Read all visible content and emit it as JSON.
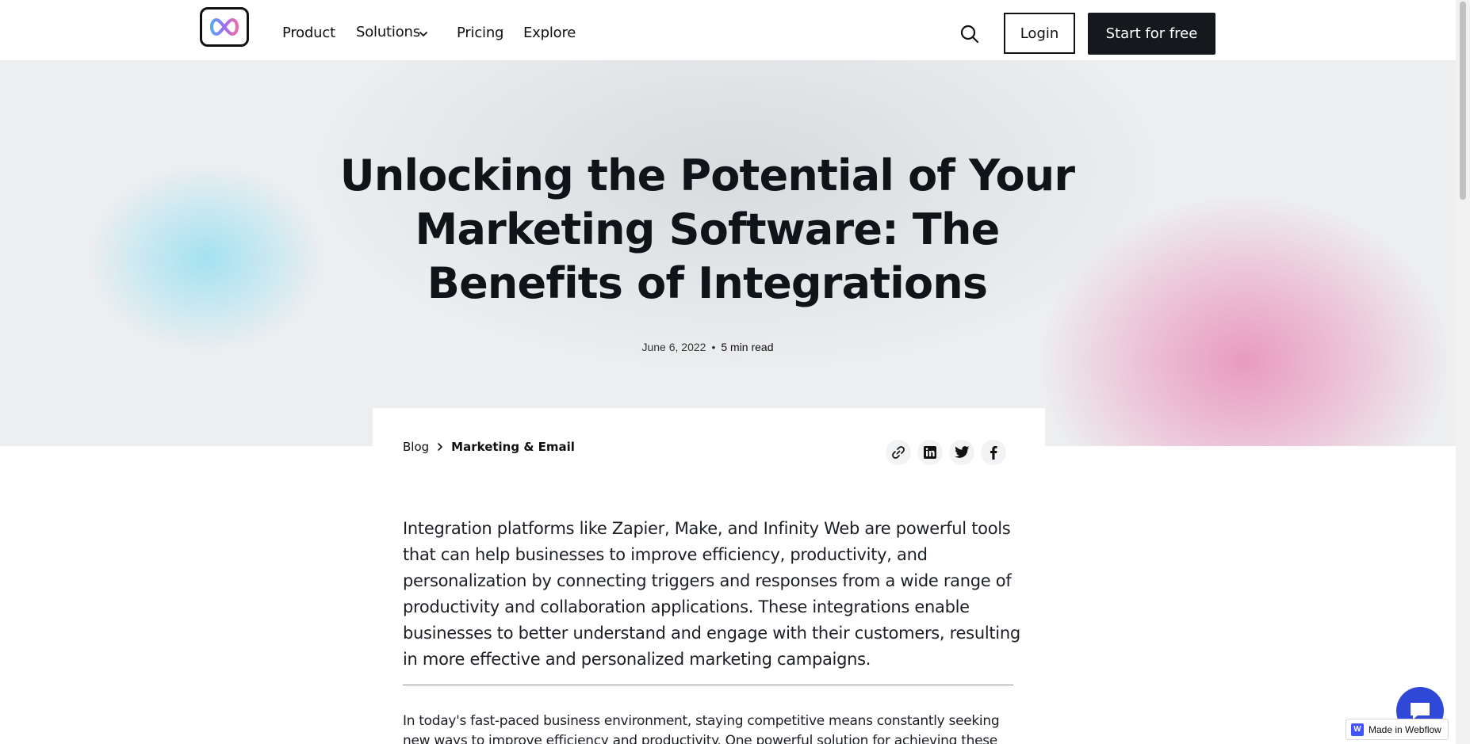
{
  "nav": {
    "logo_icon": "infinity-logo",
    "links": [
      "Product",
      "Solutions",
      "Pricing",
      "Explore"
    ],
    "login_label": "Login",
    "start_label": "Start for free"
  },
  "hero": {
    "title": "Unlocking the Potential of Your Marketing Software: The Benefits of Integrations",
    "date": "June 6, 2022",
    "separator": "•",
    "read_time": "5 min read"
  },
  "breadcrumb": {
    "root": "Blog",
    "current": "Marketing & Email"
  },
  "share_icons": [
    "link-icon",
    "linkedin-icon",
    "twitter-icon",
    "facebook-icon"
  ],
  "article": {
    "intro": "Integration platforms like Zapier, Make, and Infinity Web are powerful tools that can help businesses to improve efficiency, productivity, and personalization by connecting triggers and responses from a wide range of productivity and collaboration applications. These integrations enable businesses to better understand and engage with their customers, resulting in more effective and personalized marketing campaigns.",
    "body": "In today's fast-paced business environment, staying competitive means constantly seeking new ways to improve efficiency and productivity. One powerful solution for achieving these goals is"
  },
  "badge": {
    "label": "Made in Webflow",
    "mark": "W"
  },
  "colors": {
    "accent": "#2f48d8",
    "dark_button": "#15191e",
    "hero_bg": "#eceef0",
    "cyan_blob": "#a0e1f0",
    "pink_blob": "#e896be"
  }
}
